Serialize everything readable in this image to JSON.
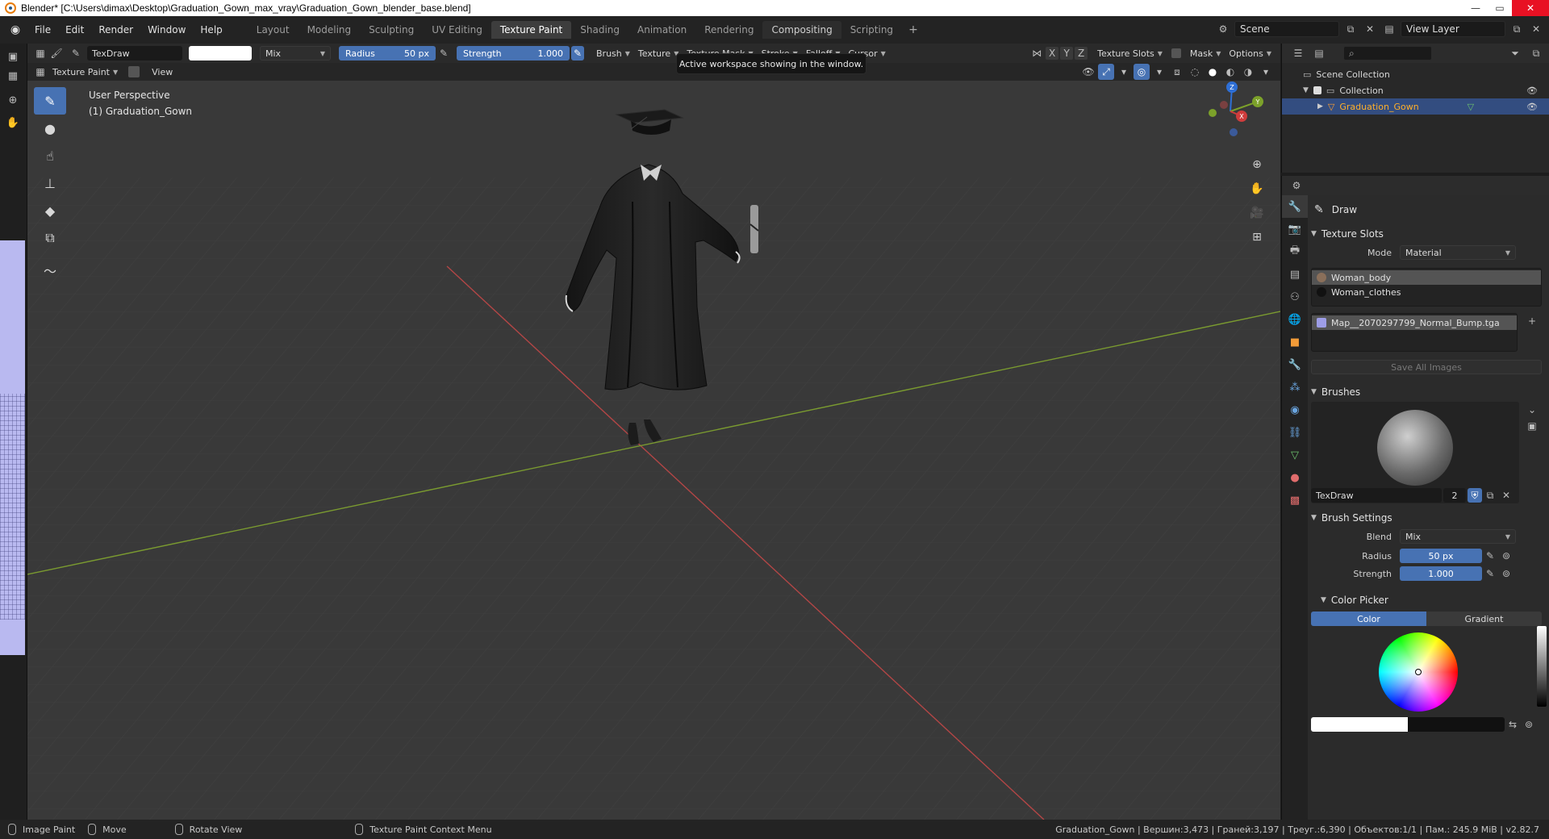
{
  "window": {
    "title": "Blender* [C:\\Users\\dimax\\Desktop\\Graduation_Gown_max_vray\\Graduation_Gown_blender_base.blend]",
    "buttons": [
      "—",
      "▭",
      "✕"
    ]
  },
  "menubar": {
    "menus": [
      "File",
      "Edit",
      "Render",
      "Window",
      "Help"
    ],
    "tabs": [
      "Layout",
      "Modeling",
      "Sculpting",
      "UV Editing",
      "Texture Paint",
      "Shading",
      "Animation",
      "Rendering",
      "Compositing",
      "Scripting"
    ],
    "active_tab": "Texture Paint",
    "hover_tab": "Compositing",
    "add_tab": "+",
    "scene": "Scene",
    "view_layer": "View Layer"
  },
  "tool_header": {
    "brush_name": "TexDraw",
    "blend": "Mix",
    "radius_label": "Radius",
    "radius_value": "50 px",
    "strength_label": "Strength",
    "strength_value": "1.000",
    "brush_menu": "Brush",
    "texture_menu": "Texture",
    "texture_mask_menu": "Texture Mask",
    "stroke_menu": "Stroke",
    "falloff_menu": "Falloff",
    "cursor_menu": "Cursor",
    "axis_x": "X",
    "axis_y": "Y",
    "axis_z": "Z",
    "texture_slots": "Texture Slots",
    "mask": "Mask",
    "options": "Options"
  },
  "viewport_header": {
    "mode": "Texture Paint",
    "view_menu": "View"
  },
  "tooltip": "Active workspace showing in the window.",
  "viewport": {
    "perspective": "User Perspective",
    "object_label": "(1) Graduation_Gown",
    "gizmo": {
      "x": "X",
      "y": "Y",
      "z": "Z"
    }
  },
  "outliner": {
    "rows": [
      {
        "label": "Scene Collection"
      },
      {
        "label": "Collection"
      },
      {
        "label": "Graduation_Gown"
      }
    ]
  },
  "properties": {
    "tool_name": "Draw",
    "texture_slots": {
      "title": "Texture Slots",
      "mode_label": "Mode",
      "mode_value": "Material",
      "materials": [
        {
          "name": "Woman_body",
          "color": "#8a6f5a"
        },
        {
          "name": "Woman_clothes",
          "color": "#111111"
        }
      ],
      "image": {
        "name": "Map__2070297799_Normal_Bump.tga",
        "color": "#9d9de6"
      },
      "save_all": "Save All Images"
    },
    "brushes": {
      "title": "Brushes",
      "brush_name": "TexDraw",
      "users": "2"
    },
    "brush_settings": {
      "title": "Brush Settings",
      "blend_label": "Blend",
      "blend_value": "Mix",
      "radius_label": "Radius",
      "radius_value": "50 px",
      "strength_label": "Strength",
      "strength_value": "1.000"
    },
    "color_picker": {
      "title": "Color Picker",
      "tab_color": "Color",
      "tab_gradient": "Gradient"
    }
  },
  "statusbar": {
    "image_paint": "Image Paint",
    "move": "Move",
    "rotate_view": "Rotate View",
    "context_menu": "Texture Paint Context Menu",
    "stats": "Graduation_Gown | Вершин:3,473 | Граней:3,197 | Треуг.:6,390 | Объектов:1/1 | Пам.: 245.9 MiB | v2.82.7"
  },
  "colors": {
    "accent": "#4772b3",
    "selected_text": "#ffaf29",
    "viewport_bg": "#393939",
    "x_axis": "#b34646",
    "y_axis": "#7a9a30"
  }
}
